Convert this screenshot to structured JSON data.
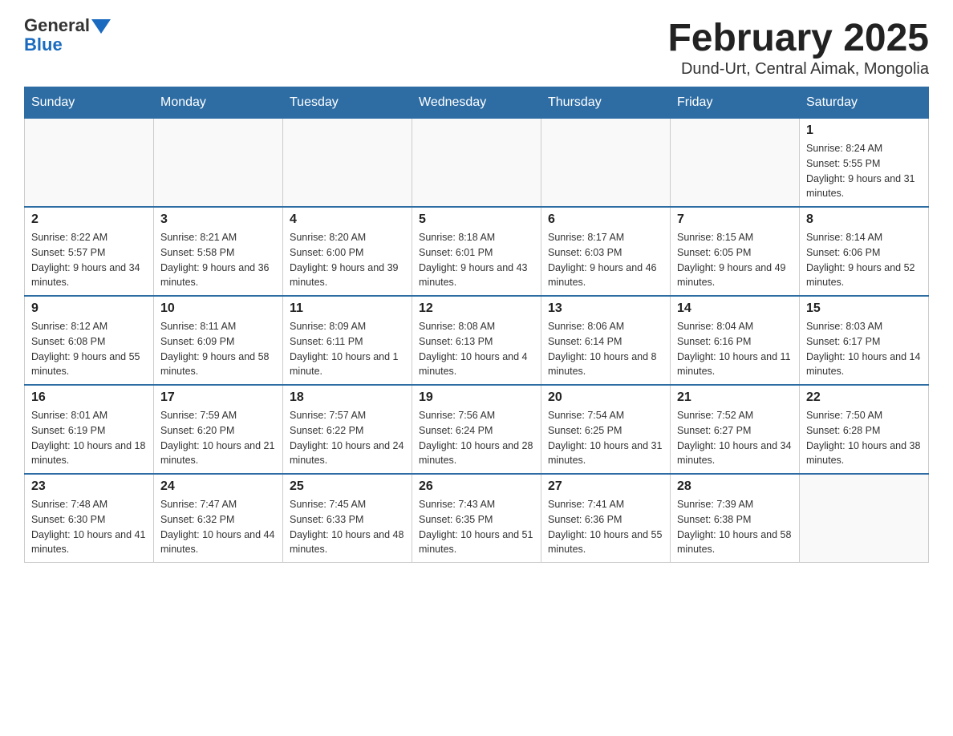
{
  "header": {
    "logo_general": "General",
    "logo_blue": "Blue",
    "title": "February 2025",
    "subtitle": "Dund-Urt, Central Aimak, Mongolia"
  },
  "days_of_week": [
    "Sunday",
    "Monday",
    "Tuesday",
    "Wednesday",
    "Thursday",
    "Friday",
    "Saturday"
  ],
  "weeks": [
    [
      {
        "day": "",
        "info": ""
      },
      {
        "day": "",
        "info": ""
      },
      {
        "day": "",
        "info": ""
      },
      {
        "day": "",
        "info": ""
      },
      {
        "day": "",
        "info": ""
      },
      {
        "day": "",
        "info": ""
      },
      {
        "day": "1",
        "info": "Sunrise: 8:24 AM\nSunset: 5:55 PM\nDaylight: 9 hours and 31 minutes."
      }
    ],
    [
      {
        "day": "2",
        "info": "Sunrise: 8:22 AM\nSunset: 5:57 PM\nDaylight: 9 hours and 34 minutes."
      },
      {
        "day": "3",
        "info": "Sunrise: 8:21 AM\nSunset: 5:58 PM\nDaylight: 9 hours and 36 minutes."
      },
      {
        "day": "4",
        "info": "Sunrise: 8:20 AM\nSunset: 6:00 PM\nDaylight: 9 hours and 39 minutes."
      },
      {
        "day": "5",
        "info": "Sunrise: 8:18 AM\nSunset: 6:01 PM\nDaylight: 9 hours and 43 minutes."
      },
      {
        "day": "6",
        "info": "Sunrise: 8:17 AM\nSunset: 6:03 PM\nDaylight: 9 hours and 46 minutes."
      },
      {
        "day": "7",
        "info": "Sunrise: 8:15 AM\nSunset: 6:05 PM\nDaylight: 9 hours and 49 minutes."
      },
      {
        "day": "8",
        "info": "Sunrise: 8:14 AM\nSunset: 6:06 PM\nDaylight: 9 hours and 52 minutes."
      }
    ],
    [
      {
        "day": "9",
        "info": "Sunrise: 8:12 AM\nSunset: 6:08 PM\nDaylight: 9 hours and 55 minutes."
      },
      {
        "day": "10",
        "info": "Sunrise: 8:11 AM\nSunset: 6:09 PM\nDaylight: 9 hours and 58 minutes."
      },
      {
        "day": "11",
        "info": "Sunrise: 8:09 AM\nSunset: 6:11 PM\nDaylight: 10 hours and 1 minute."
      },
      {
        "day": "12",
        "info": "Sunrise: 8:08 AM\nSunset: 6:13 PM\nDaylight: 10 hours and 4 minutes."
      },
      {
        "day": "13",
        "info": "Sunrise: 8:06 AM\nSunset: 6:14 PM\nDaylight: 10 hours and 8 minutes."
      },
      {
        "day": "14",
        "info": "Sunrise: 8:04 AM\nSunset: 6:16 PM\nDaylight: 10 hours and 11 minutes."
      },
      {
        "day": "15",
        "info": "Sunrise: 8:03 AM\nSunset: 6:17 PM\nDaylight: 10 hours and 14 minutes."
      }
    ],
    [
      {
        "day": "16",
        "info": "Sunrise: 8:01 AM\nSunset: 6:19 PM\nDaylight: 10 hours and 18 minutes."
      },
      {
        "day": "17",
        "info": "Sunrise: 7:59 AM\nSunset: 6:20 PM\nDaylight: 10 hours and 21 minutes."
      },
      {
        "day": "18",
        "info": "Sunrise: 7:57 AM\nSunset: 6:22 PM\nDaylight: 10 hours and 24 minutes."
      },
      {
        "day": "19",
        "info": "Sunrise: 7:56 AM\nSunset: 6:24 PM\nDaylight: 10 hours and 28 minutes."
      },
      {
        "day": "20",
        "info": "Sunrise: 7:54 AM\nSunset: 6:25 PM\nDaylight: 10 hours and 31 minutes."
      },
      {
        "day": "21",
        "info": "Sunrise: 7:52 AM\nSunset: 6:27 PM\nDaylight: 10 hours and 34 minutes."
      },
      {
        "day": "22",
        "info": "Sunrise: 7:50 AM\nSunset: 6:28 PM\nDaylight: 10 hours and 38 minutes."
      }
    ],
    [
      {
        "day": "23",
        "info": "Sunrise: 7:48 AM\nSunset: 6:30 PM\nDaylight: 10 hours and 41 minutes."
      },
      {
        "day": "24",
        "info": "Sunrise: 7:47 AM\nSunset: 6:32 PM\nDaylight: 10 hours and 44 minutes."
      },
      {
        "day": "25",
        "info": "Sunrise: 7:45 AM\nSunset: 6:33 PM\nDaylight: 10 hours and 48 minutes."
      },
      {
        "day": "26",
        "info": "Sunrise: 7:43 AM\nSunset: 6:35 PM\nDaylight: 10 hours and 51 minutes."
      },
      {
        "day": "27",
        "info": "Sunrise: 7:41 AM\nSunset: 6:36 PM\nDaylight: 10 hours and 55 minutes."
      },
      {
        "day": "28",
        "info": "Sunrise: 7:39 AM\nSunset: 6:38 PM\nDaylight: 10 hours and 58 minutes."
      },
      {
        "day": "",
        "info": ""
      }
    ]
  ]
}
